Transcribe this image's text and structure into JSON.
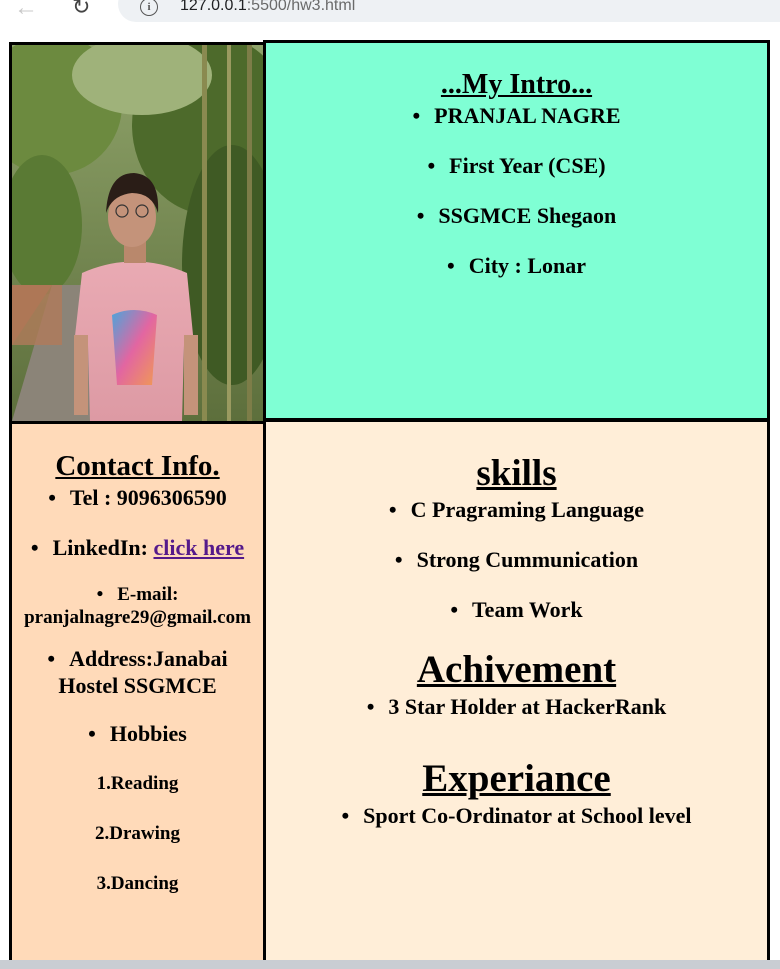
{
  "browser": {
    "url_host": "127.0.0.1",
    "url_path": ":5500/hw3.html"
  },
  "intro": {
    "title": "...My Intro...",
    "items": [
      "PRANJAL NAGRE",
      "First Year (CSE)",
      "SSGMCE Shegaon",
      "City : Lonar"
    ]
  },
  "contact": {
    "title": "Contact Info.",
    "tel": "Tel : 9096306590",
    "linkedin_label": "LinkedIn:",
    "linkedin_link": "click here",
    "email_label": "E-mail:",
    "email_value": "pranjalnagre29@gmail.com",
    "address_line1": "Address:Janabai",
    "address_line2": "Hostel SSGMCE",
    "hobbies_label": "Hobbies",
    "hobbies": [
      "1.Reading",
      "2.Drawing",
      "3.Dancing"
    ]
  },
  "skills": {
    "title": "skills",
    "items": [
      "C Pragraming Language",
      "Strong Cummunication",
      "Team Work"
    ]
  },
  "achievement": {
    "title": "Achivement",
    "items": [
      "3 Star Holder at HackerRank"
    ]
  },
  "experience": {
    "title": "Experiance",
    "items": [
      "Sport Co-Ordinator at School level"
    ]
  },
  "colors": {
    "intro_bg": "#7fffd4",
    "contact_bg": "#ffdab9",
    "skills_bg": "#ffeed8",
    "link": "#551a8b"
  }
}
